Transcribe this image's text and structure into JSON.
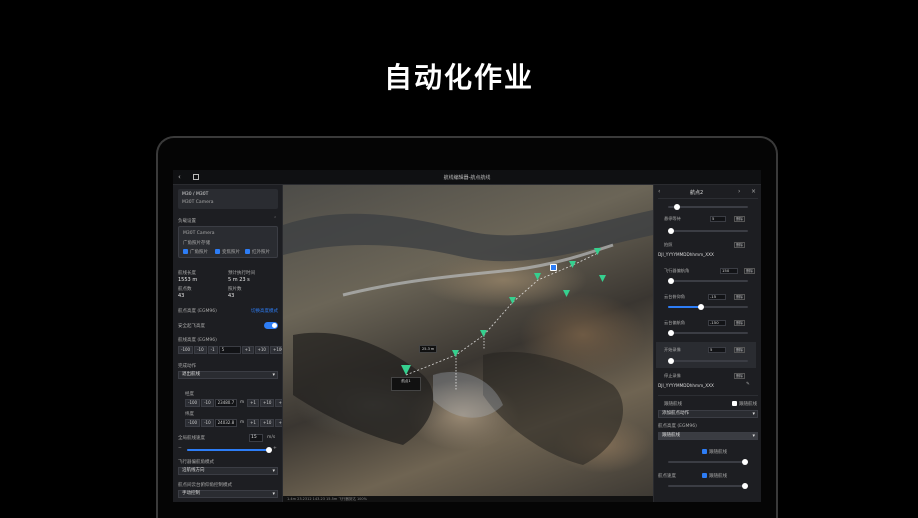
{
  "headline": "自动化作业",
  "window": {
    "title": "航线编辑器-航点航线",
    "back_icon": "chevron-left-icon",
    "layer_icon": "panel-icon"
  },
  "left_panel": {
    "drone": "M30 / M30T",
    "camera": "M30T Camera",
    "section_label": "负载设置",
    "payload_name": "M30T Camera",
    "payload_sub": "广角照片存储",
    "checks": [
      "广角照片",
      "变焦照片",
      "红外照片"
    ],
    "stats": [
      {
        "label": "航线长度",
        "value": "1553 m"
      },
      {
        "label": "预计执行时间",
        "value": "5 m 23 s"
      },
      {
        "label": "航点数",
        "value": "43"
      },
      {
        "label": "照片数",
        "value": "43"
      }
    ],
    "height_ref_label": "航点高度 (EGM96)",
    "height_ref_link": "切换高度模式",
    "safe_takeoff_label": "安全起飞高度",
    "altitude_label": "航线高度 (EGM96)",
    "altitude_stepper": [
      "-100",
      "-10",
      "-1",
      "5",
      "+1",
      "+10",
      "+100"
    ],
    "mode_label": "完成动作",
    "mode_value": "退出航线",
    "lat_label": "经度",
    "lat_value": "23480.7",
    "lng_label": "纬度",
    "lng_value": "24032.8",
    "unit_m": "m",
    "speed_label": "全局航线速度",
    "speed_value": "15",
    "speed_unit": "m/s",
    "yaw_label": "飞行器偏航角模式",
    "yaw_value": "沿航线方向",
    "gimbal_label": "航点间云台俯仰角控制模式",
    "gimbal_value": "手动控制"
  },
  "map": {
    "distance_label": "25.3 m",
    "marker_label_top": "航点1",
    "status": "1.4m  23.2312  143.23  15.5m  飞行器到达 100%"
  },
  "right_panel": {
    "title": "航点2",
    "rows": [
      {
        "label": "悬停等待",
        "value": "5",
        "unit": "s",
        "btn": "删除"
      },
      {
        "label": "拍照",
        "btn": "删除"
      },
      {
        "label": "DJI_YYYYMMDDhhmm_XXX",
        "btn": ""
      },
      {
        "label": "飞行器偏航角",
        "value": "150",
        "btn": "删除"
      },
      {
        "label": "云台俯仰角",
        "value": "-15",
        "btn": "删除"
      },
      {
        "label": "云台偏航角",
        "value": "-150",
        "btn": "删除"
      },
      {
        "label": "开始录像",
        "value": "5",
        "btn": "删除"
      },
      {
        "label": "停止录像",
        "btn": "删除"
      },
      {
        "label": "DJI_YYYYMMDDhhmm_XXX",
        "btn": ""
      }
    ],
    "follow_label": "跟随航线",
    "follow_check": "跟随航线",
    "action_select": "添加航点动作",
    "altitude_label": "航点高度 (EGM96)",
    "altitude_select": "跟随航线",
    "altitude_check": "跟随航线",
    "speed_label": "航点速度",
    "speed_check": "跟随航线"
  }
}
